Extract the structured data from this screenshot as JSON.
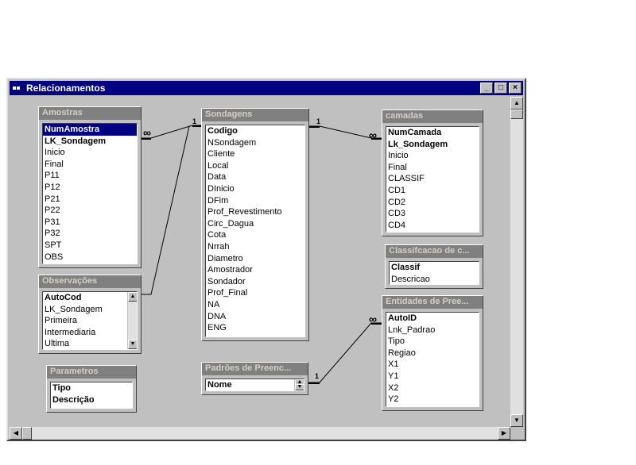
{
  "window": {
    "title": "Relacionamentos",
    "min": "_",
    "max": "□",
    "close": "×"
  },
  "tables": {
    "amostras": {
      "title": "Amostras",
      "fields": [
        "NumAmostra",
        "LK_Sondagem",
        "Inicio",
        "Final",
        "P11",
        "P12",
        "P21",
        "P22",
        "P31",
        "P32",
        "SPT",
        "OBS"
      ]
    },
    "observacoes": {
      "title": "Observações",
      "fields": [
        "AutoCod",
        "LK_Sondagem",
        "Primeira",
        "Intermediaria",
        "Ultima"
      ]
    },
    "parametros": {
      "title": "Parametros",
      "fields": [
        "Tipo",
        "Descrição"
      ]
    },
    "sondagens": {
      "title": "Sondagens",
      "fields": [
        "Codigo",
        "NSondagem",
        "Cliente",
        "Local",
        "Data",
        "DInicio",
        "DFim",
        "Prof_Revestimento",
        "Circ_Dagua",
        "Cota",
        "Nrrah",
        "Diametro",
        "Amostrador",
        "Sondador",
        "Prof_Final",
        "NA",
        "DNA",
        "ENG"
      ]
    },
    "padroes": {
      "title": "Padrões de Preenc...",
      "fields": [
        "Nome"
      ]
    },
    "camadas": {
      "title": "camadas",
      "fields": [
        "NumCamada",
        "Lk_Sondagem",
        "Inicio",
        "Final",
        "CLASSIF",
        "CD1",
        "CD2",
        "CD3",
        "CD4"
      ]
    },
    "classif": {
      "title": "Classifcacao de c...",
      "fields": [
        "Classif",
        "Descricao"
      ]
    },
    "entidades": {
      "title": "Entidades de Pree...",
      "fields": [
        "AutoID",
        "Lnk_Padrao",
        "Tipo",
        "Regiao",
        "X1",
        "Y1",
        "X2",
        "Y2"
      ]
    }
  },
  "relationships": [
    {
      "one": "1",
      "many": "∞"
    },
    {
      "one": "1",
      "many": "∞"
    },
    {
      "one": "1",
      "many": "∞"
    }
  ],
  "icons": [
    "window-app-icon",
    "minimize-icon",
    "maximize-icon",
    "close-icon",
    "scroll-up-icon",
    "scroll-down-icon",
    "scroll-left-icon",
    "scroll-right-icon"
  ]
}
